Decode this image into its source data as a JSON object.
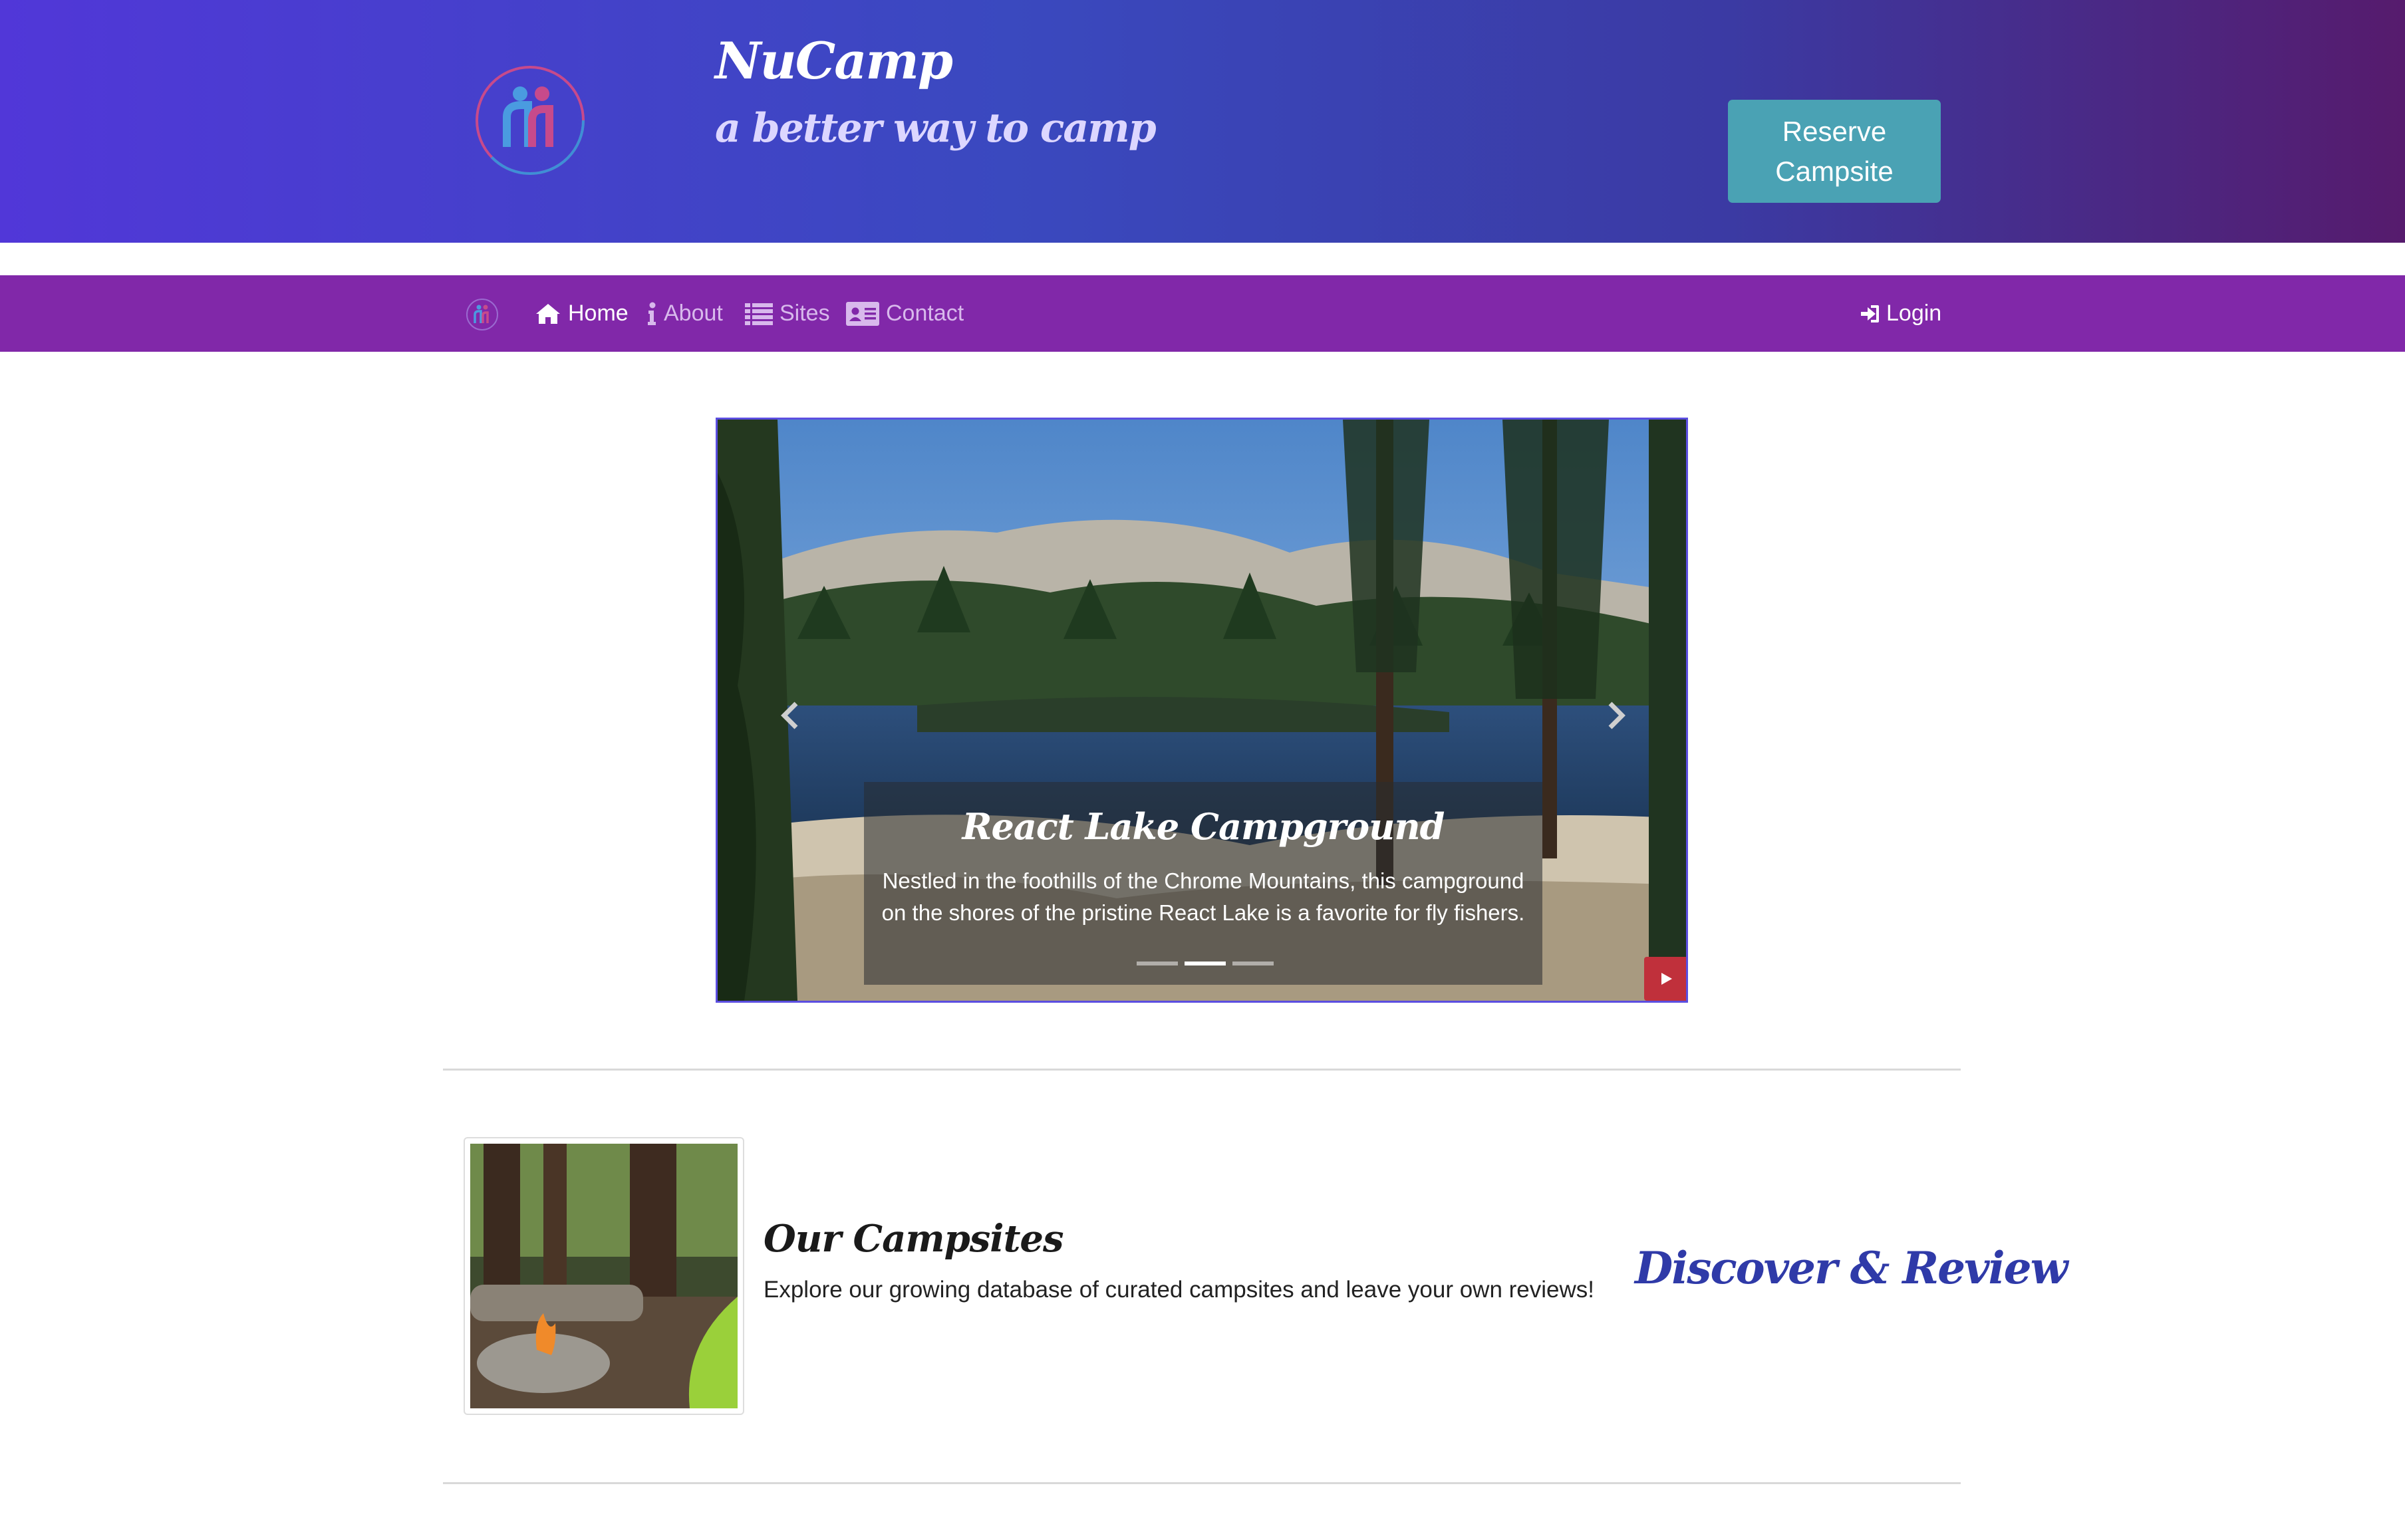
{
  "header": {
    "title": "NuCamp",
    "tagline": "a better way to camp",
    "reserve_button": "Reserve Campsite"
  },
  "nav": {
    "items": [
      {
        "label": "Home",
        "icon": "home-icon",
        "active": true
      },
      {
        "label": "About",
        "icon": "info-icon",
        "active": false
      },
      {
        "label": "Sites",
        "icon": "list-icon",
        "active": false
      },
      {
        "label": "Contact",
        "icon": "address-card-icon",
        "active": false
      }
    ],
    "login": {
      "label": "Login",
      "icon": "sign-in-icon"
    }
  },
  "carousel": {
    "title": "React Lake Campground",
    "description": "Nestled in the foothills of the Chrome Mountains, this campground on the shores of the pristine React Lake is a favorite for fly fishers.",
    "slide_count": 3,
    "active_slide": 2
  },
  "feature": {
    "heading": "Our Campsites",
    "text": "Explore our growing database of curated campsites and leave your own reviews!",
    "link": "Discover & Review"
  },
  "colors": {
    "header_gradient_start": "#5137d8",
    "header_gradient_end": "#561b6d",
    "navbar": "#8128a9",
    "reserve_button": "#4aa2b4",
    "discover_link": "#2f3aa8",
    "play_button": "#c0303b"
  }
}
